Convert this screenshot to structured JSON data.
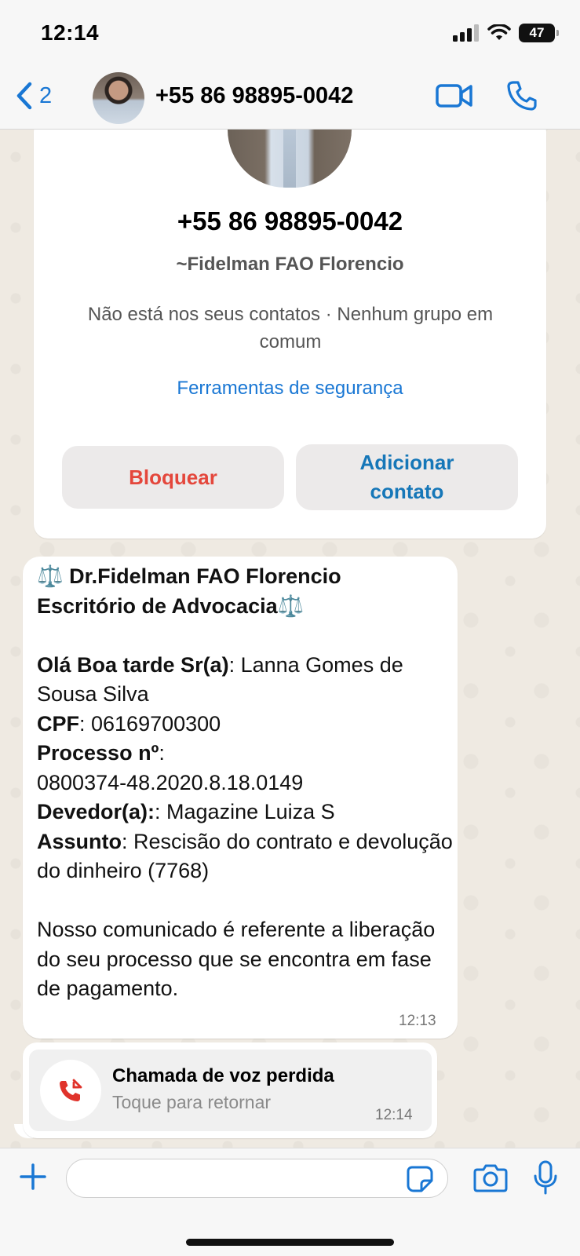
{
  "status_bar": {
    "time": "12:14",
    "battery": "47"
  },
  "header": {
    "back_count": "2",
    "contact_title": "+55 86 98895-0042"
  },
  "profile_card": {
    "phone": "+55 86 98895-0042",
    "name": "~Fidelman FAO Florencio",
    "info": "Não está nos seus contatos · Nenhum grupo em comum",
    "security_link": "Ferramentas de segurança",
    "block_label": "Bloquear",
    "add_contact_label": "Adicionar contato"
  },
  "message": {
    "title_line1": "⚖️ Dr.Fidelman FAO Florencio",
    "title_line2": "Escritório de Advocacia⚖️",
    "greeting_label": "Olá Boa tarde Sr(a)",
    "greeting_value": ": Lanna Gomes de Sousa Silva",
    "cpf_label": "CPF",
    "cpf_value": ": 06169700300",
    "process_label": "Processo nº",
    "process_value": ":\n0800374-48.2020.8.18.0149",
    "debtor_label": "Devedor(a):",
    "debtor_value": ": Magazine Luiza S",
    "subject_label": "Assunto",
    "subject_value": ": Rescisão do contrato e devolução do dinheiro (7768)",
    "body": "Nosso comunicado é referente a liberação do seu processo que se encontra em fase de pagamento.",
    "time": "12:13"
  },
  "missed_call": {
    "title": "Chamada de voz perdida",
    "subtitle": "Toque para retornar",
    "time": "12:14"
  },
  "colors": {
    "accent_blue": "#1977d4",
    "block_red": "#e4473c",
    "add_blue": "#1677b8",
    "missed_call_red": "#e0332b"
  }
}
